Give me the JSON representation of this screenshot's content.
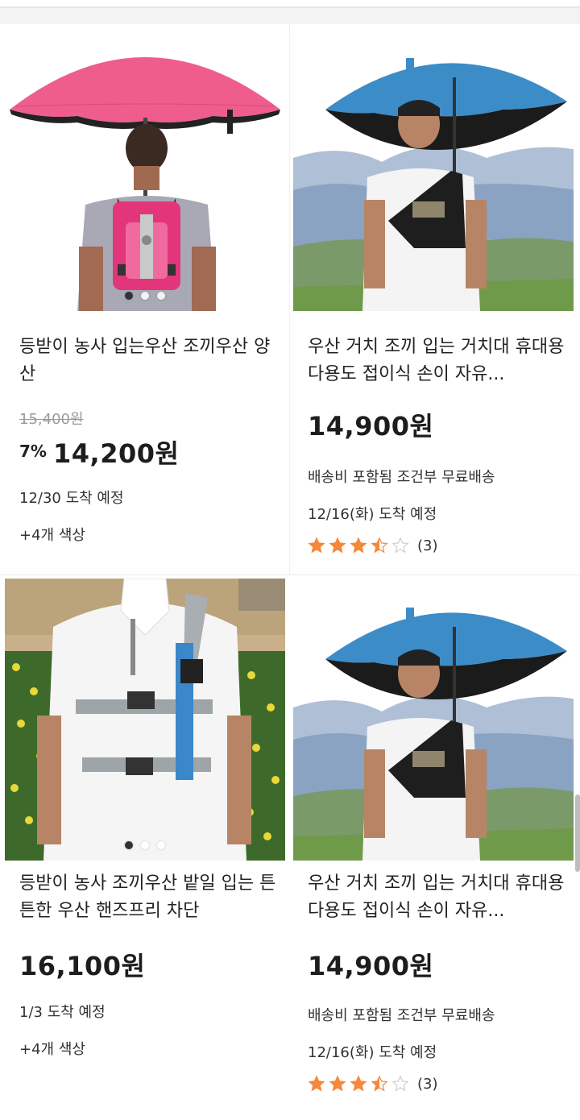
{
  "products": [
    {
      "title": "등받이 농사 입는우산 조끼우산 양산",
      "original_price": "15,400원",
      "discount": "7%",
      "price": "14,200원",
      "delivery": "12/30 도착 예정",
      "colors": "+4개 색상"
    },
    {
      "title": "우산 거치 조끼 입는 거치대 휴대용 다용도 접이식 손이 자유...",
      "price": "14,900원",
      "shipping": "배송비 포함됨 조건부 무료배송",
      "delivery": "12/16(화) 도착 예정",
      "rating": 3.5,
      "rating_count": "(3)"
    },
    {
      "title": "등받이 농사 조끼우산 밭일 입는 튼튼한 우산 핸즈프리 차단",
      "price": "16,100원",
      "delivery": "1/3 도착 예정",
      "colors": "+4개 색상"
    },
    {
      "title": "우산 거치 조끼 입는 거치대 휴대용 다용도 접이식 손이 자유...",
      "price": "14,900원",
      "shipping": "배송비 포함됨 조건부 무료배송",
      "delivery": "12/16(화) 도착 예정",
      "rating": 3.5,
      "rating_count": "(3)"
    }
  ],
  "colors": {
    "star": "#f5883a",
    "umbrella_pink": "#ef5d8d",
    "umbrella_blue": "#3c8cc8"
  }
}
